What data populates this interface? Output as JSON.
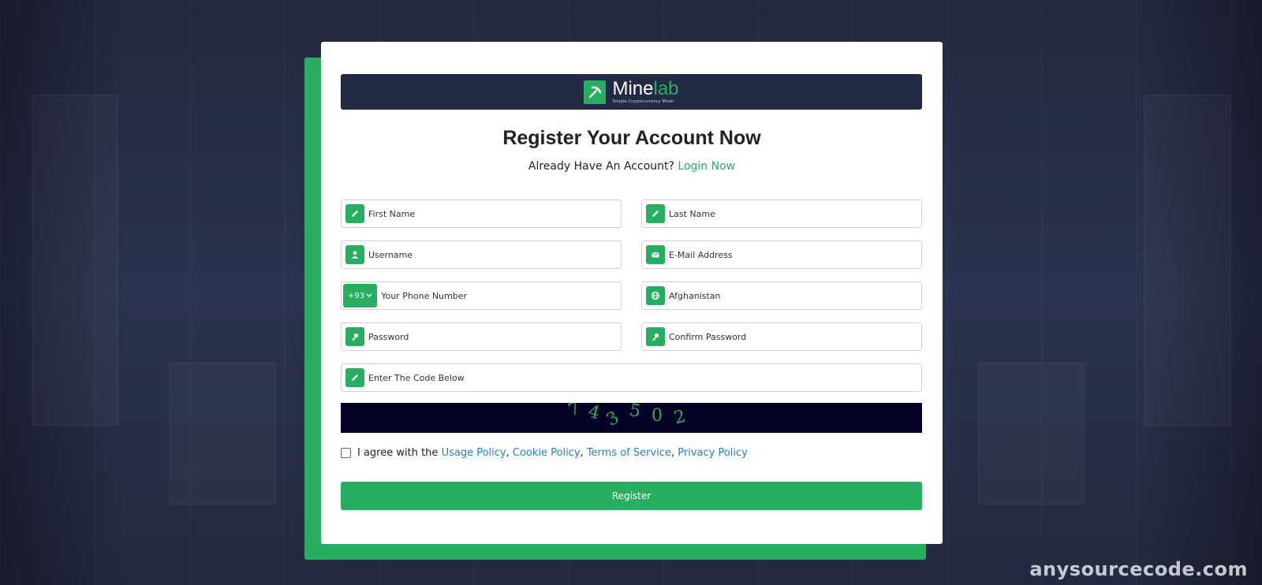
{
  "brand": {
    "name_a": "Mine",
    "name_b": "lab",
    "tagline": "Simple Cryptocurrency Miner"
  },
  "header": {
    "title": "Register Your Account Now",
    "subtitle": "Already Have An Account?",
    "login_link": "Login Now"
  },
  "form": {
    "first_name": {
      "placeholder": "First Name",
      "icon": "pencil-icon"
    },
    "last_name": {
      "placeholder": "Last Name",
      "icon": "pencil-icon"
    },
    "username": {
      "placeholder": "Username",
      "icon": "user-icon"
    },
    "email": {
      "placeholder": "E-Mail Address",
      "icon": "envelope-icon"
    },
    "phone": {
      "dial_code": "+93",
      "placeholder": "Your Phone Number"
    },
    "country": {
      "value": "Afghanistan",
      "icon": "globe-icon"
    },
    "password": {
      "placeholder": "Password",
      "icon": "key-icon"
    },
    "confirm_password": {
      "placeholder": "Confirm Password",
      "icon": "key-icon"
    },
    "captcha_input": {
      "placeholder": "Enter The Code Below",
      "icon": "pencil-icon"
    },
    "captcha_code": [
      "7",
      "4",
      "3",
      "5",
      "0",
      "2"
    ]
  },
  "agreement": {
    "text": "I agree with the",
    "usage": "Usage Policy",
    "sep1": ",",
    "cookie": "Cookie Policy",
    "sep2": ",",
    "terms": "Terms of Service",
    "sep3": ",",
    "privacy": "Privacy Policy"
  },
  "register_label": "Register",
  "watermark": "anysourcecode.com",
  "colors": {
    "accent": "#27ae60",
    "dark": "#232a44",
    "link": "#1e7fe0",
    "captcha_bg": "#020226"
  }
}
